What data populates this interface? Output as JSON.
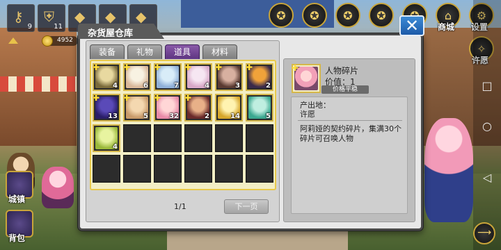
{
  "hud": {
    "slots": [
      {
        "icon": "key-icon",
        "count": "9"
      },
      {
        "icon": "armor-icon",
        "count": "11"
      },
      {
        "icon": "item-icon",
        "count": ""
      },
      {
        "icon": "item-icon",
        "count": ""
      },
      {
        "icon": "item-icon",
        "count": ""
      }
    ],
    "coins": "4952"
  },
  "top_right": {
    "shop_label": "商城",
    "settings_label": "设置",
    "extra_label": "许愿"
  },
  "side": {
    "town_label": "城镇",
    "bag_label": "背包"
  },
  "dialog": {
    "title": "杂货屋仓库",
    "close_glyph": "✕",
    "tabs": [
      {
        "label": "装备",
        "active": false
      },
      {
        "label": "礼物",
        "active": false
      },
      {
        "label": "道具",
        "active": true
      },
      {
        "label": "材料",
        "active": false
      }
    ],
    "items": [
      {
        "qty": "4",
        "plus": true,
        "palette": [
          "#e8d9a0",
          "#7a6a3a"
        ]
      },
      {
        "qty": "6",
        "plus": true,
        "palette": [
          "#f8f2e2",
          "#d9b89a"
        ]
      },
      {
        "qty": "7",
        "plus": true,
        "palette": [
          "#d8ecf8",
          "#8fb0d8"
        ]
      },
      {
        "qty": "4",
        "plus": true,
        "palette": [
          "#f6e6f2",
          "#d8a8c8"
        ]
      },
      {
        "qty": "3",
        "plus": true,
        "palette": [
          "#d8b0a0",
          "#5a3a32"
        ]
      },
      {
        "qty": "2",
        "plus": true,
        "palette": [
          "#f0a23a",
          "#3a2a4a"
        ]
      },
      {
        "qty": "13",
        "plus": true,
        "palette": [
          "#5a4ab8",
          "#2a1e68"
        ]
      },
      {
        "qty": "5",
        "plus": true,
        "palette": [
          "#f4d8b0",
          "#c89a6a"
        ]
      },
      {
        "qty": "32",
        "plus": true,
        "palette": [
          "#ffd6d6",
          "#e88aa8"
        ]
      },
      {
        "qty": "2",
        "plus": true,
        "palette": [
          "#e8b088",
          "#6a2a2a"
        ]
      },
      {
        "qty": "14",
        "plus": false,
        "palette": [
          "#fff3b0",
          "#d6a62a"
        ]
      },
      {
        "qty": "5",
        "plus": false,
        "palette": [
          "#bfeee0",
          "#3aa890"
        ]
      },
      {
        "qty": "4",
        "plus": false,
        "palette": [
          "#e8f4a0",
          "#9ab83a"
        ]
      }
    ],
    "page": "1/1",
    "next_label": "下一页",
    "detail": {
      "name": "人物碎片",
      "value": "价值：1",
      "price_note": "价格平稳",
      "source_label": "产出地：",
      "source_value": "许愿",
      "description": "阿莉娅的契约碎片，集满30个碎片可召唤人物"
    }
  },
  "colors": {
    "active_tab": "#6e3f92",
    "grid_border": "#e8c94b",
    "close_button": "#2b73c2"
  }
}
